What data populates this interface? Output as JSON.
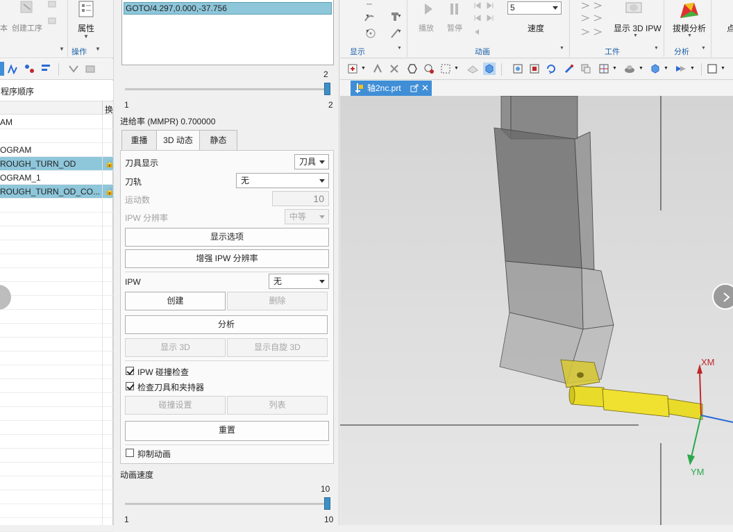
{
  "left": {
    "ribbon": {
      "item_ben": "本",
      "create_op_label": "创建工序",
      "properties_label": "属性",
      "group_label": "操作"
    },
    "nav_header": "程序顺序",
    "col_right": "换",
    "rows": [
      {
        "text": "AM",
        "selected": false,
        "lock": false
      },
      {
        "text": "",
        "selected": false,
        "lock": false
      },
      {
        "text": "OGRAM",
        "selected": false,
        "lock": false
      },
      {
        "text": "ROUGH_TURN_OD",
        "selected": true,
        "lock": true
      },
      {
        "text": "OGRAM_1",
        "selected": false,
        "lock": false
      },
      {
        "text": "ROUGH_TURN_OD_CO...",
        "selected": true,
        "lock": true
      }
    ]
  },
  "dialog": {
    "list_line": "GOTO/4.297,0.000,-37.756",
    "slider1": {
      "max_label": "2",
      "min_label": "1",
      "right_label": "2",
      "value": 1.0
    },
    "feed_rate": "进给率 (MMPR) 0.700000",
    "tabs": [
      "重播",
      "3D 动态",
      "静态"
    ],
    "active_tab": 1,
    "tool_display_label": "刀具显示",
    "tool_display_value": "刀具",
    "toolpath_label": "刀轨",
    "toolpath_value": "无",
    "motion_count_label": "运动数",
    "motion_count_value": "10",
    "ipw_res_label": "IPW 分辨率",
    "ipw_res_value": "中等",
    "show_options_btn": "显示选项",
    "enhance_ipw_btn": "增强 IPW 分辨率",
    "ipw_label": "IPW",
    "ipw_value": "无",
    "create_btn": "创建",
    "delete_btn": "删除",
    "analyze_btn": "分析",
    "show3d_btn": "显示 3D",
    "show_rot3d_btn": "显示自旋 3D",
    "ipw_collision_label": "IPW 碰撞检查",
    "ipw_collision_checked": true,
    "check_tool_holder_label": "检查刀具和夹持器",
    "check_tool_holder_checked": true,
    "collision_settings_btn": "碰撞设置",
    "list_btn": "列表",
    "reset_btn": "重置",
    "suppress_anim_label": "抑制动画",
    "suppress_anim_checked": false,
    "anim_speed_label": "动画速度",
    "slider2": {
      "max_label": "10",
      "min_label": "1",
      "right_label": "10",
      "value": 1.0
    }
  },
  "right": {
    "ribbon": {
      "play_label": "播放",
      "pause_label": "暂停",
      "speed_value": "5",
      "speed_label": "速度",
      "show3dipw_label": "显示 3D IPW",
      "draft_analysis_label": "拔模分析",
      "dot_label": "点",
      "group_display": "显示",
      "group_animation": "动画",
      "group_workpiece": "工件",
      "group_analysis": "分析"
    },
    "doc_tab": "轴2nc.prt",
    "axis_xm": "XM",
    "axis_ym": "YM",
    "colors": {
      "accent": "#3f8ed6",
      "selection": "#8ec6da",
      "axis_x": "#c0282a",
      "axis_y": "#2aa84a",
      "axis_z": "#2a6ad6",
      "tool": "#f0e030"
    }
  }
}
